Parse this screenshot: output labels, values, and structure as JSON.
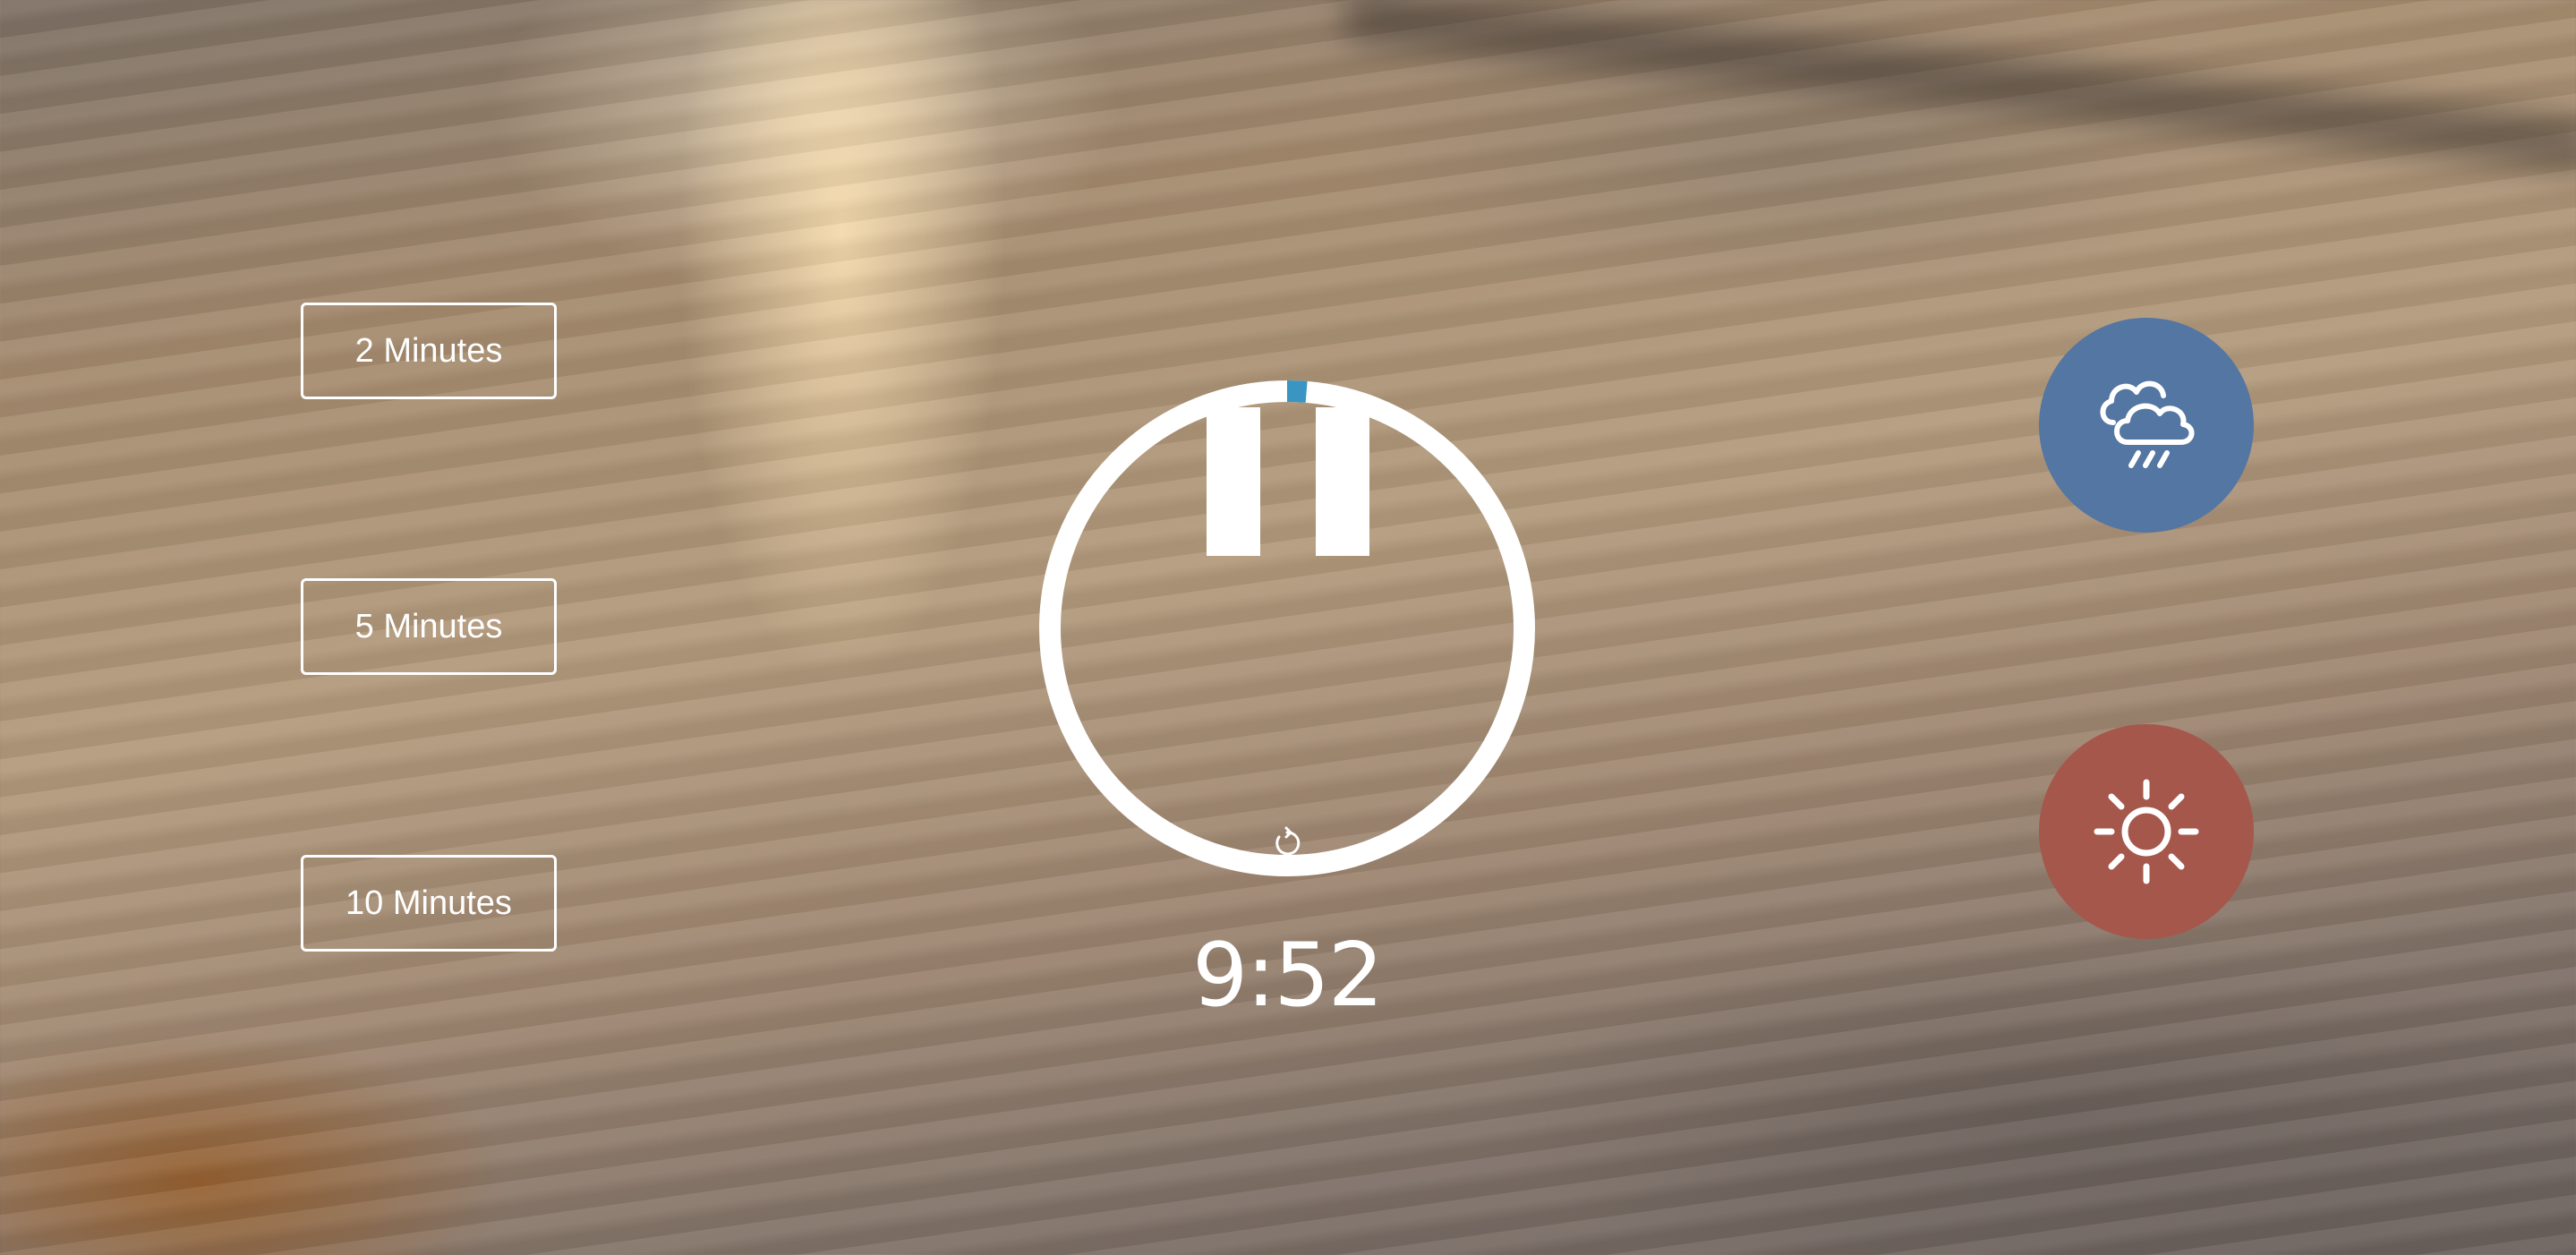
{
  "presets": {
    "two": "2 Minutes",
    "five": "5 Minutes",
    "ten": "10 Minutes"
  },
  "timer": {
    "remaining": "9:52",
    "elapsed_fraction": 0.013,
    "state": "running"
  },
  "icons": {
    "pause": "pause-icon",
    "reset": "reset-icon",
    "rain": "rain-cloud-icon",
    "sun": "sun-icon"
  },
  "colors": {
    "progress": "#3a95c2",
    "rain_button": "#5476a2",
    "sun_button": "#a5574c",
    "foreground": "#ffffff"
  }
}
